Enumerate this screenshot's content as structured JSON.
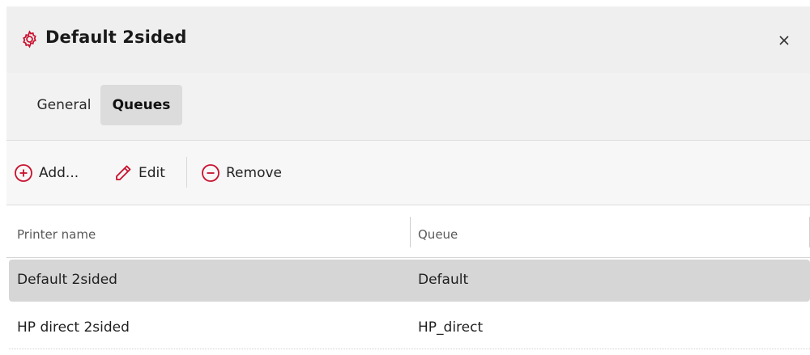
{
  "dialog": {
    "title": "Default 2sided",
    "title_icon": "gear-icon",
    "close_icon": "close-icon",
    "accent_color": "#c8102e"
  },
  "tabs": [
    {
      "label": "General",
      "active": false
    },
    {
      "label": "Queues",
      "active": true
    }
  ],
  "toolbar": {
    "add_label": "Add...",
    "add_icon": "plus-circle-icon",
    "edit_label": "Edit",
    "edit_icon": "pencil-icon",
    "remove_label": "Remove",
    "remove_icon": "minus-circle-icon"
  },
  "table": {
    "columns": [
      "Printer name",
      "Queue"
    ],
    "rows": [
      {
        "printer_name": "Default 2sided",
        "queue": "Default",
        "selected": true
      },
      {
        "printer_name": "HP direct 2sided",
        "queue": "HP_direct",
        "selected": false
      }
    ]
  }
}
